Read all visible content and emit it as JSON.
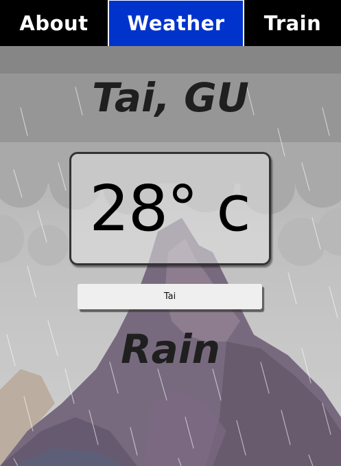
{
  "nav": {
    "tabs": [
      {
        "label": "About",
        "active": false
      },
      {
        "label": "Weather",
        "active": true
      },
      {
        "label": "Train",
        "active": false
      }
    ],
    "active_color": "#0033cc"
  },
  "weather": {
    "city": "Tai, GU",
    "temperature": "28°",
    "unit": "c",
    "condition": "Rain"
  },
  "search": {
    "value": "Tai"
  },
  "background": {
    "theme": "rain-clouds-mountain"
  }
}
